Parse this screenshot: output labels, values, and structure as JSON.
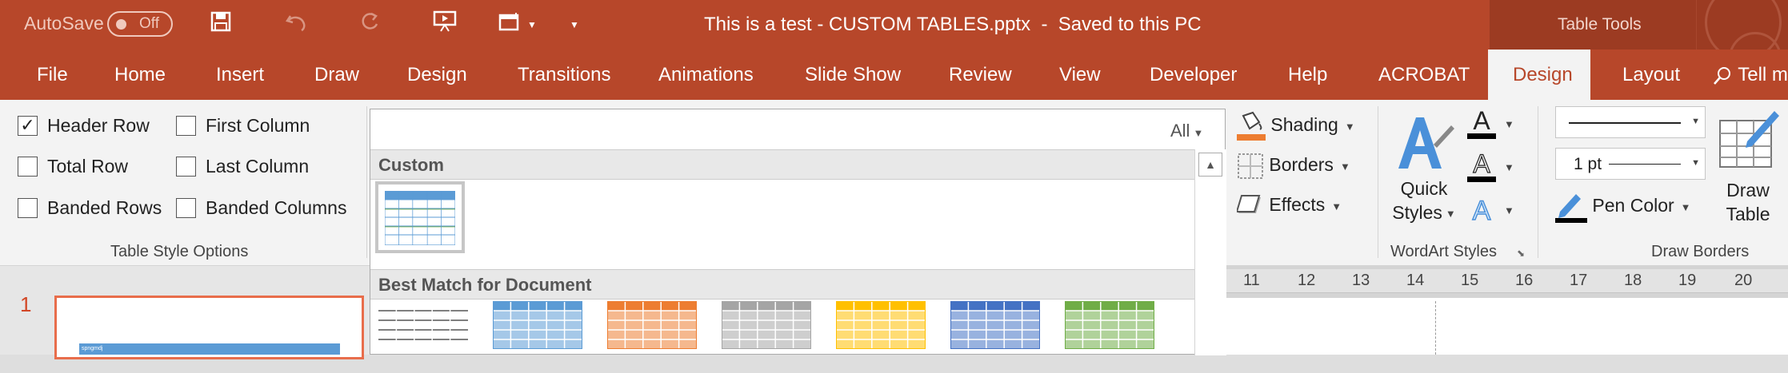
{
  "titlebar": {
    "autosave_label": "AutoSave",
    "autosave_state": "Off",
    "document_title": "This is a test - CUSTOM TABLES.pptx  -  Saved to this PC",
    "context_label": "Table Tools",
    "qat_icons": [
      "save-icon",
      "undo-icon",
      "redo-icon",
      "present-from-start-icon",
      "insert-table-icon",
      "customize-qat-icon"
    ]
  },
  "tabs": [
    {
      "label": "File"
    },
    {
      "label": "Home"
    },
    {
      "label": "Insert"
    },
    {
      "label": "Draw"
    },
    {
      "label": "Design"
    },
    {
      "label": "Transitions"
    },
    {
      "label": "Animations"
    },
    {
      "label": "Slide Show"
    },
    {
      "label": "Review"
    },
    {
      "label": "View"
    },
    {
      "label": "Developer"
    },
    {
      "label": "Help"
    },
    {
      "label": "ACROBAT"
    },
    {
      "label": "Design"
    },
    {
      "label": "Layout"
    }
  ],
  "active_tab": "Design",
  "tell_me": "Tell m",
  "table_style_options": {
    "label": "Table Style Options",
    "header_row": {
      "label": "Header Row",
      "checked": true
    },
    "first_column": {
      "label": "First Column",
      "checked": false
    },
    "total_row": {
      "label": "Total Row",
      "checked": false
    },
    "last_column": {
      "label": "Last Column",
      "checked": false
    },
    "banded_rows": {
      "label": "Banded Rows",
      "checked": false
    },
    "banded_columns": {
      "label": "Banded Columns",
      "checked": false
    }
  },
  "gallery": {
    "filter": "All",
    "section_custom": "Custom",
    "section_best_match": "Best Match for Document",
    "best_match_colors": [
      "#ffffff",
      "#5b9bd5",
      "#ed7d31",
      "#a5a5a5",
      "#ffc000",
      "#4472c4",
      "#70ad47"
    ]
  },
  "table_styles": {
    "shading": "Shading",
    "borders": "Borders",
    "effects": "Effects"
  },
  "wordart": {
    "quick_styles_line1": "Quick",
    "quick_styles_line2": "Styles",
    "label": "WordArt Styles"
  },
  "draw_borders": {
    "pen_weight": "1 pt",
    "pen_color": "Pen Color",
    "draw_table_line1": "Draw",
    "draw_table_line2": "Table",
    "label": "Draw Borders"
  },
  "ruler_numbers": [
    "11",
    "12",
    "13",
    "14",
    "15",
    "16",
    "17",
    "18",
    "19",
    "20"
  ],
  "slide_pane": {
    "slide_number": "1",
    "thumb_text": "spngmdj"
  },
  "colors": {
    "accent": "#b7472a",
    "shading_swatch": "#ed7d31"
  }
}
